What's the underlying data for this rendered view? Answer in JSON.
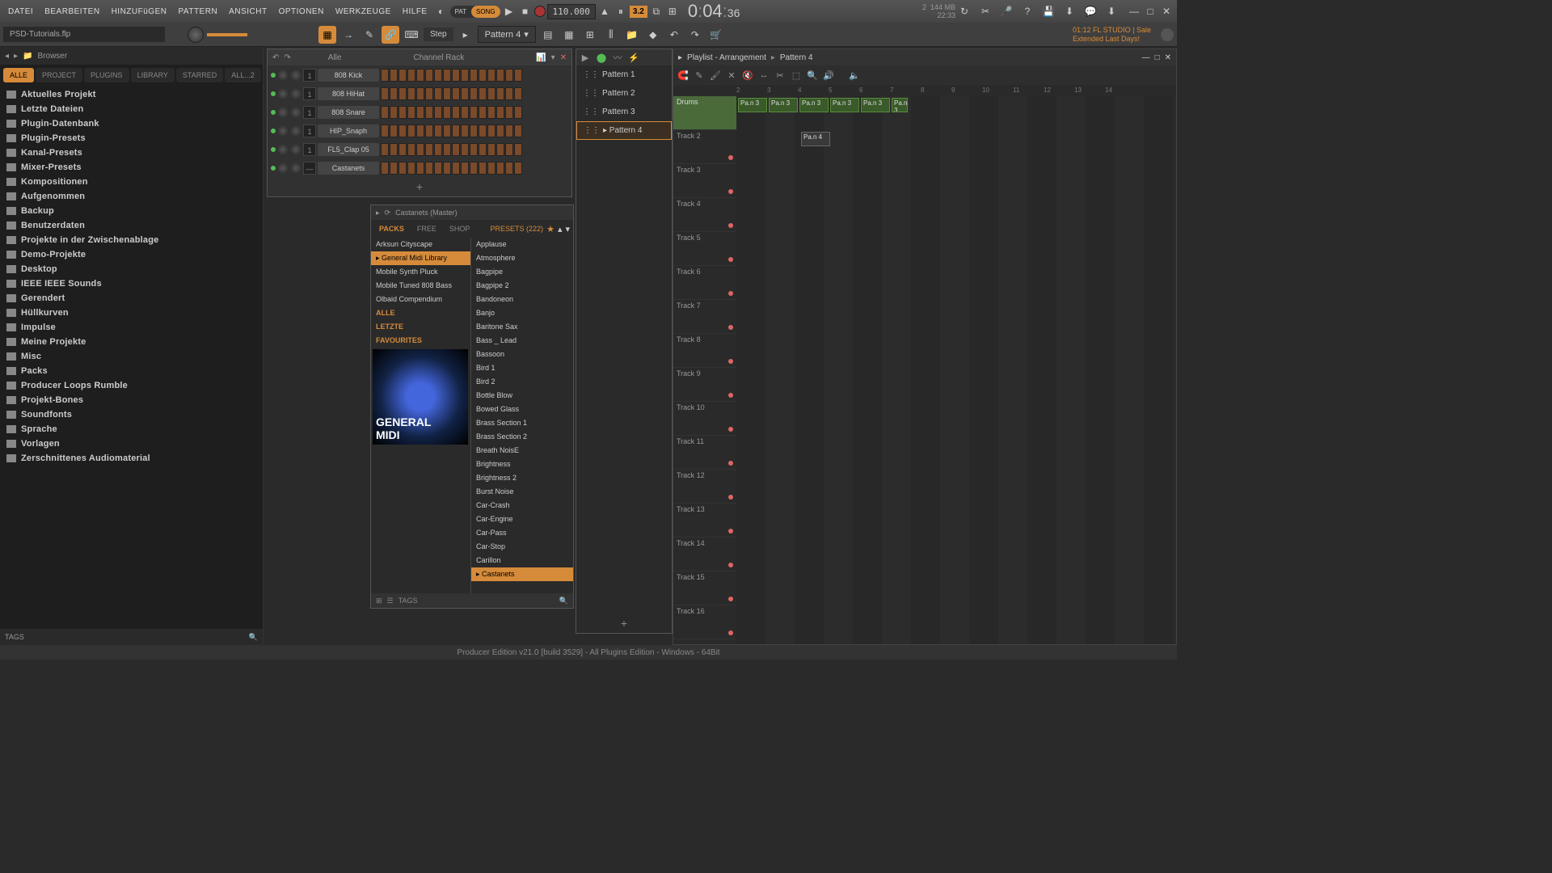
{
  "menu": [
    "DATEI",
    "BEARBEITEN",
    "HINZUFüGEN",
    "PATTERN",
    "ANSICHT",
    "OPTIONEN",
    "WERKZEUGE",
    "HILFE"
  ],
  "patSong": {
    "pat": "PAT",
    "song": "SONG"
  },
  "tempo": "110.000",
  "snap": "3.2",
  "counter": {
    "a": "0",
    "b": "04",
    "c": "36"
  },
  "stats": {
    "cpu": "2",
    "mem": "144 MB",
    "time": "22:33"
  },
  "filename": "PSD-Tutorials.flp",
  "stepLabel": "Step",
  "patternBox": "Pattern 4",
  "rightInfo": {
    "l1": "01:12  FL STUDIO | Sale",
    "l2": "Extended Last Days!"
  },
  "browser": {
    "title": "Browser",
    "tabs": [
      "ALLE",
      "PROJECT",
      "PLUGINS",
      "LIBRARY",
      "STARRED",
      "ALL...2"
    ],
    "items": [
      "Aktuelles Projekt",
      "Letzte Dateien",
      "Plugin-Datenbank",
      "Plugin-Presets",
      "Kanal-Presets",
      "Mixer-Presets",
      "Kompositionen",
      "Aufgenommen",
      "Backup",
      "Benutzerdaten",
      "Projekte in der Zwischenablage",
      "Demo-Projekte",
      "Desktop",
      "IEEE IEEE Sounds",
      "Gerendert",
      "Hüllkurven",
      "Impulse",
      "Meine Projekte",
      "Misc",
      "Packs",
      "Producer Loops Rumble",
      "Projekt-Bones",
      "Soundfonts",
      "Sprache",
      "Vorlagen",
      "Zerschnittenes Audiomaterial"
    ],
    "ftr": "TAGS"
  },
  "chrack": {
    "all": "Alle",
    "title": "Channel Rack",
    "channels": [
      {
        "num": "1",
        "name": "808 Kick"
      },
      {
        "num": "1",
        "name": "808 HiHat"
      },
      {
        "num": "1",
        "name": "808 Snare"
      },
      {
        "num": "1",
        "name": "HIP_Snaph"
      },
      {
        "num": "1",
        "name": "FL5_Clap 05"
      },
      {
        "num": "—",
        "name": "Castanets"
      }
    ]
  },
  "preset": {
    "hdr": "Castanets (Master)",
    "tabs": [
      "PACKS",
      "FREE",
      "SHOP"
    ],
    "countLabel": "PRESETS (222)",
    "packs": [
      "Arksun Cityscape",
      "General Midi Library",
      "Mobile Synth Pluck",
      "Mobile Tuned 808 Bass",
      "Olbaid Compendium"
    ],
    "cats": [
      "ALLE",
      "LETZTE",
      "FAVOURITES"
    ],
    "presets": [
      "Applause",
      "Atmosphere",
      "Bagpipe",
      "Bagpipe 2",
      "Bandoneon",
      "Banjo",
      "Baritone Sax",
      "Bass _ Lead",
      "Bassoon",
      "Bird 1",
      "Bird 2",
      "Bottle Blow",
      "Bowed Glass",
      "Brass Section 1",
      "Brass Section 2",
      "Breath NoisE",
      "Brightness",
      "Brightness 2",
      "Burst Noise",
      "Car-Crash",
      "Car-Engine",
      "Car-Pass",
      "Car-Stop",
      "Carillon",
      "Castanets"
    ],
    "imgLabel": "GENERAL\nMIDI",
    "ftr": "TAGS"
  },
  "patpick": {
    "items": [
      "Pattern 1",
      "Pattern 2",
      "Pattern 3",
      "Pattern 4"
    ]
  },
  "playlist": {
    "title": "Playlist - Arrangement",
    "pattern": "Pattern 4",
    "ruler": [
      "2",
      "3",
      "4",
      "5",
      "6",
      "7",
      "8",
      "9",
      "10",
      "11",
      "12",
      "13",
      "14"
    ],
    "tracks": [
      "Drums",
      "Track 2",
      "Track 3",
      "Track 4",
      "Track 5",
      "Track 6",
      "Track 7",
      "Track 8",
      "Track 9",
      "Track 10",
      "Track 11",
      "Track 12",
      "Track 13",
      "Track 14",
      "Track 15",
      "Track 16"
    ],
    "clips": [
      "Pa.n 3",
      "Pa.n 3",
      "Pa.n 3",
      "Pa.n 3",
      "Pa.n 3",
      "Pa.n 3",
      "Pa.n 4"
    ]
  },
  "footer": "Producer Edition v21.0 [build 3529] - All Plugins Edition - Windows - 64Bit"
}
